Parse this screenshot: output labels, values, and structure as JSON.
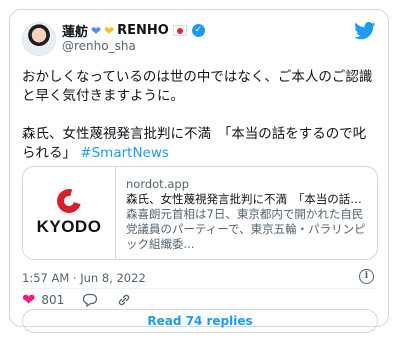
{
  "author": {
    "display_name": "蓮舫",
    "display_name_suffix": "RENHO",
    "handle": "@renho_sha",
    "badges": [
      "blue-heart",
      "yellow-heart",
      "japan-flag",
      "verified-badge"
    ]
  },
  "tweet": {
    "line1": "おかしくなっているのは世の中ではなく、ご本人のご認識と早く気付きますように。",
    "line2_text": "森氏、女性蔑視発言批判に不満　「本当の話をするので叱られる」",
    "hashtag": "#SmartNews"
  },
  "link_card": {
    "domain": "nordot.app",
    "title": "森氏、女性蔑視発言批判に不満　「本当の話をする...",
    "description": "森喜朗元首相は7日、東京都内で開かれた自民党議員のパーティーで、東京五輪・パラリンピック組織委...",
    "thumbnail_text": "KYODO"
  },
  "meta": {
    "time": "1:57 AM · Jun 8, 2022"
  },
  "actions": {
    "likes": "801"
  },
  "read_replies_label": "Read 74 replies",
  "colors": {
    "accent": "#1d9bf0",
    "like": "#f91880",
    "muted": "#536471",
    "border": "#cfd9de",
    "kyodo_red": "#d7202f"
  },
  "icons": [
    "twitter-bird-icon",
    "info-icon",
    "heart-icon",
    "reply-icon",
    "copy-link-icon"
  ]
}
